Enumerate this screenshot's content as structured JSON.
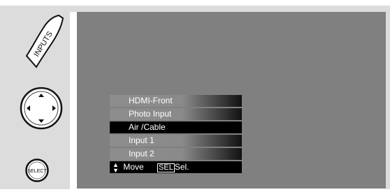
{
  "remote": {
    "inputs_label": "INPUTS",
    "select_label": "SELECT"
  },
  "menu": {
    "items": [
      {
        "label": "HDMI-Front",
        "selected": false
      },
      {
        "label": "Photo Input",
        "selected": false
      },
      {
        "label": "Air /Cable",
        "selected": true
      },
      {
        "label": "Input 1",
        "selected": false
      },
      {
        "label": "Input 2",
        "selected": false
      }
    ],
    "footer": {
      "arrows": "▲▼",
      "move_label": "Move",
      "sel_key": "SEL",
      "sel_label": "Sel."
    }
  },
  "colors": {
    "screen": "#808080",
    "remote_panel": "#dcdcdc",
    "selected_bg": "#000000"
  }
}
